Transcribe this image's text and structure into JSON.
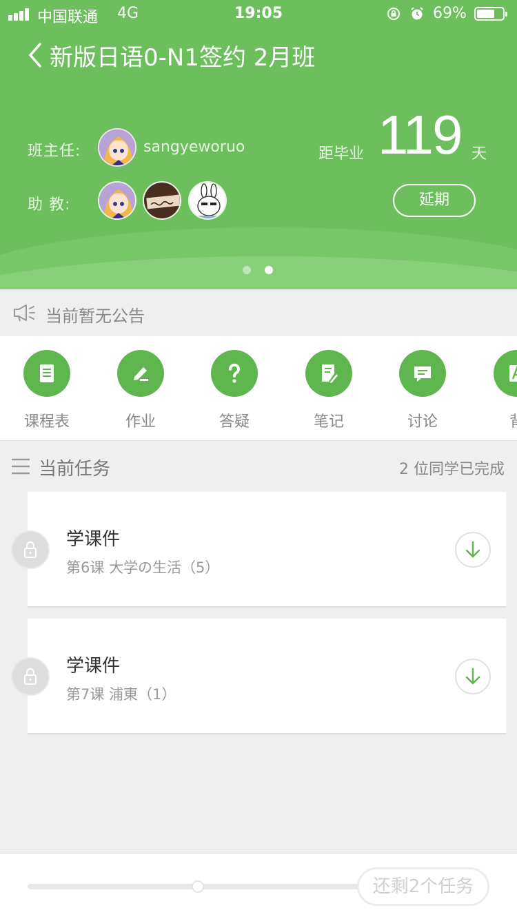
{
  "status_bar": {
    "carrier": "中国联通",
    "network": "4G",
    "time": "19:05",
    "battery": "69%",
    "battery_level": 0.69
  },
  "header": {
    "title": "新版日语0-N1签约 2月班",
    "head_teacher_label": "班主任:",
    "head_teacher_name": "sangyeworuo",
    "assistant_label": "助  教:",
    "graduation_label": "距毕业",
    "graduation_days": "119",
    "graduation_unit": "天",
    "delay_button": "延期",
    "pager_count": 2,
    "pager_active": 1
  },
  "announcement": {
    "text": "当前暂无公告",
    "icon": "megaphone-icon"
  },
  "tools": [
    {
      "label": "课程表",
      "icon": "schedule-icon"
    },
    {
      "label": "作业",
      "icon": "pencil-icon"
    },
    {
      "label": "答疑",
      "icon": "question-icon"
    },
    {
      "label": "笔记",
      "icon": "notes-icon"
    },
    {
      "label": "讨论",
      "icon": "chat-icon"
    },
    {
      "label": "背",
      "icon": "recite-icon"
    }
  ],
  "tasks": {
    "title": "当前任务",
    "completed_text": "2 位同学已完成",
    "items": [
      {
        "title": "学课件",
        "lesson": "第6课",
        "topic": "大学の生活（5）"
      },
      {
        "title": "学课件",
        "lesson": "第7课",
        "topic": "浦東（1）"
      }
    ]
  },
  "bottom": {
    "remaining_button": "还剩2个任务"
  },
  "colors": {
    "brand_green": "#6cbf5c",
    "icon_green": "#5fb64f",
    "background": "#efefef"
  }
}
